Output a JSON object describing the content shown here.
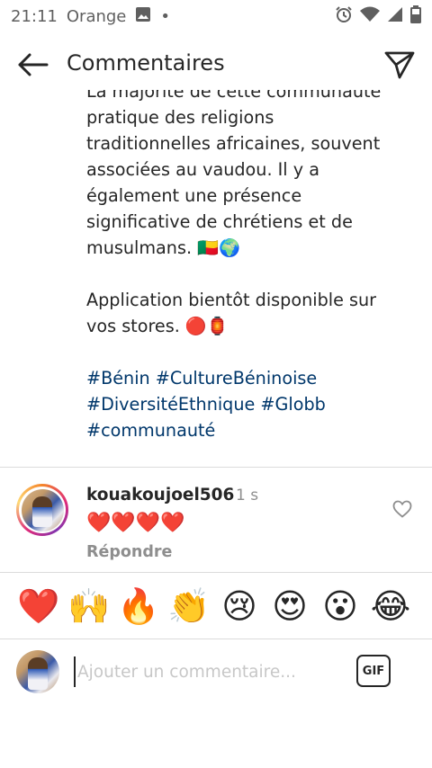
{
  "status_bar": {
    "time": "21:11",
    "carrier": "Orange",
    "dot": "•",
    "icons": [
      "image-icon",
      "alarm-icon",
      "wifi-icon",
      "signal-icon",
      "battery-icon"
    ]
  },
  "header": {
    "title": "Commentaires",
    "back_icon": "arrow-left-icon",
    "send_icon": "paper-plane-icon"
  },
  "caption": {
    "cut_line": "La majorité de cette communauté",
    "lines_p1": [
      "pratique des religions",
      "traditionnelles africaines, souvent",
      "associées au vaudou. Il y a",
      "également une présence",
      "significative de chrétiens et de",
      "musulmans. 🇧🇯🌍"
    ],
    "lines_p2": [
      "Application bientôt disponible sur",
      "vos stores. 🔴🏮"
    ],
    "hashtags": [
      "#Bénin #CultureBéninoise",
      "#DiversitéEthnique #Globb",
      "#communauté"
    ]
  },
  "comment": {
    "username": "kouakoujoel506",
    "time": "1 s",
    "text": "❤️❤️❤️❤️",
    "reply_label": "Répondre",
    "like_icon": "heart-outline-icon"
  },
  "quick_reactions": [
    "❤️",
    "🙌",
    "🔥",
    "👏",
    "😢",
    "😍",
    "😮",
    "😂"
  ],
  "compose": {
    "placeholder": "Ajouter un commentaire...",
    "gif_label": "GIF"
  },
  "colors": {
    "text": "#262626",
    "secondary": "#8e8e8e",
    "hashtag": "#00376b",
    "divider": "#dbdbdb"
  }
}
